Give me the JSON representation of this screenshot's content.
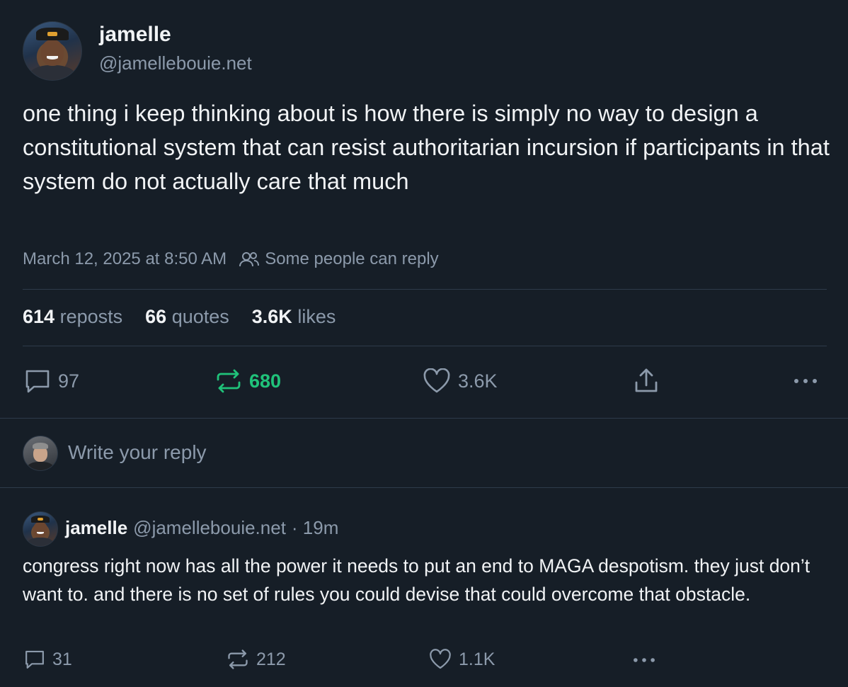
{
  "post": {
    "author_name": "jamelle",
    "author_handle": "@jamellebouie.net",
    "text": "one thing i keep thinking about is how there is simply no way to design a constitutional system that can resist authoritarian incursion if participants in that system do not actually care that much",
    "timestamp": "March 12, 2025 at 8:50 AM",
    "reply_restriction": "Some people can reply",
    "stats": {
      "reposts_count": "614",
      "reposts_label": "reposts",
      "quotes_count": "66",
      "quotes_label": "quotes",
      "likes_count": "3.6K",
      "likes_label": "likes"
    },
    "actions": {
      "reply_count": "97",
      "repost_count": "680",
      "like_count": "3.6K"
    }
  },
  "composer": {
    "placeholder": "Write your reply"
  },
  "reply": {
    "author_name": "jamelle",
    "author_handle": "@jamellebouie.net",
    "age": "· 19m",
    "text": "congress right now has all the power it needs to put an end to MAGA despotism. they just don’t want to. and there is no set of rules you could devise that could overcome that obstacle.",
    "actions": {
      "reply_count": "31",
      "repost_count": "212",
      "like_count": "1.1K"
    }
  },
  "colors": {
    "background": "#161e27",
    "muted_text": "#8c9aab",
    "repost_active": "#20c27a",
    "divider": "#2e3b4a"
  },
  "icons": [
    "reply-bubble-icon",
    "repost-icon",
    "heart-icon",
    "share-icon",
    "more-dots-icon",
    "people-icon"
  ]
}
